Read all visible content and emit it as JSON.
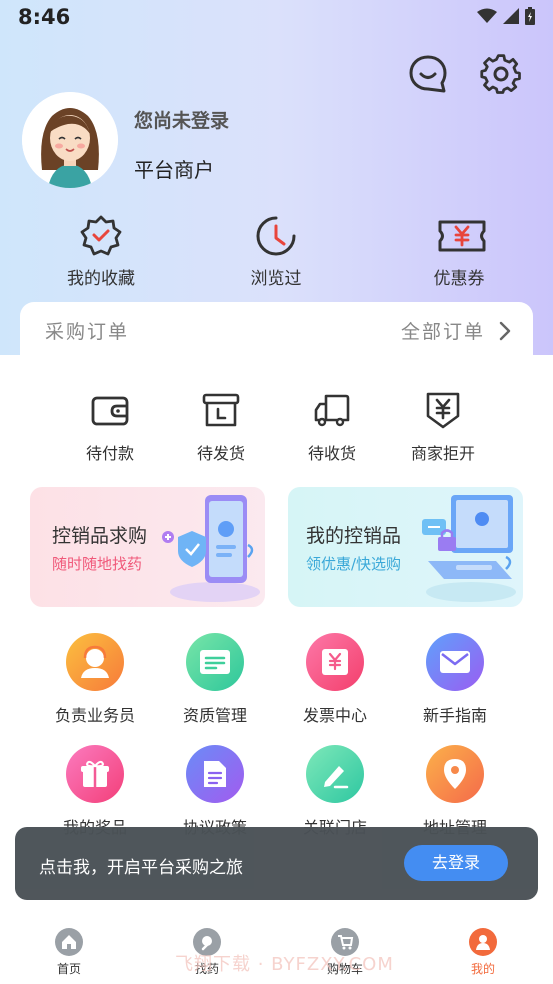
{
  "status": {
    "time": "8:46"
  },
  "header": {
    "login_status": "您尚未登录",
    "merchant_label": "平台商户"
  },
  "quick_links": [
    {
      "label": "我的收藏",
      "icon": "favorites-badge-icon"
    },
    {
      "label": "浏览过",
      "icon": "history-clock-icon"
    },
    {
      "label": "优惠券",
      "icon": "coupon-icon"
    }
  ],
  "orders": {
    "title": "采购订单",
    "all_label": "全部订单",
    "statuses": [
      {
        "label": "待付款",
        "icon": "wallet-icon"
      },
      {
        "label": "待发货",
        "icon": "box-icon"
      },
      {
        "label": "待收货",
        "icon": "truck-icon"
      },
      {
        "label": "商家拒开",
        "icon": "yen-shield-icon"
      }
    ]
  },
  "promos": [
    {
      "title": "控销品求购",
      "subtitle": "随时随地找药",
      "subtitle_color": "#f0597a"
    },
    {
      "title": "我的控销品",
      "subtitle": "领优惠/快选购",
      "subtitle_color": "#3aa8d8"
    }
  ],
  "services": [
    {
      "label": "负责业务员",
      "icon": "salesperson-icon",
      "color": "#f7a23e"
    },
    {
      "label": "资质管理",
      "icon": "qualification-icon",
      "color": "#3fcf9b"
    },
    {
      "label": "发票中心",
      "icon": "invoice-icon",
      "color": "#f55b8c"
    },
    {
      "label": "新手指南",
      "icon": "guide-mail-icon",
      "color": "#7b6bf2"
    },
    {
      "label": "我的奖品",
      "icon": "gift-icon",
      "color": "#f35a96"
    },
    {
      "label": "协议政策",
      "icon": "document-icon",
      "color": "#8a62f0"
    },
    {
      "label": "关联门店",
      "icon": "store-edit-icon",
      "color": "#44d3a4"
    },
    {
      "label": "地址管理",
      "icon": "location-icon",
      "color": "#f7894a"
    }
  ],
  "toast": {
    "message": "点击我，开启平台采购之旅",
    "button": "去登录"
  },
  "tabbar": [
    {
      "label": "首页",
      "icon": "home-icon"
    },
    {
      "label": "找药",
      "icon": "find-drug-icon"
    },
    {
      "label": "购物车",
      "icon": "cart-icon"
    },
    {
      "label": "我的",
      "icon": "profile-icon"
    }
  ],
  "watermark": "飞翔下载 · BYFZXY.COM",
  "colors": {
    "accent": "#3e8af2",
    "active_tab": "#f26a3c"
  }
}
